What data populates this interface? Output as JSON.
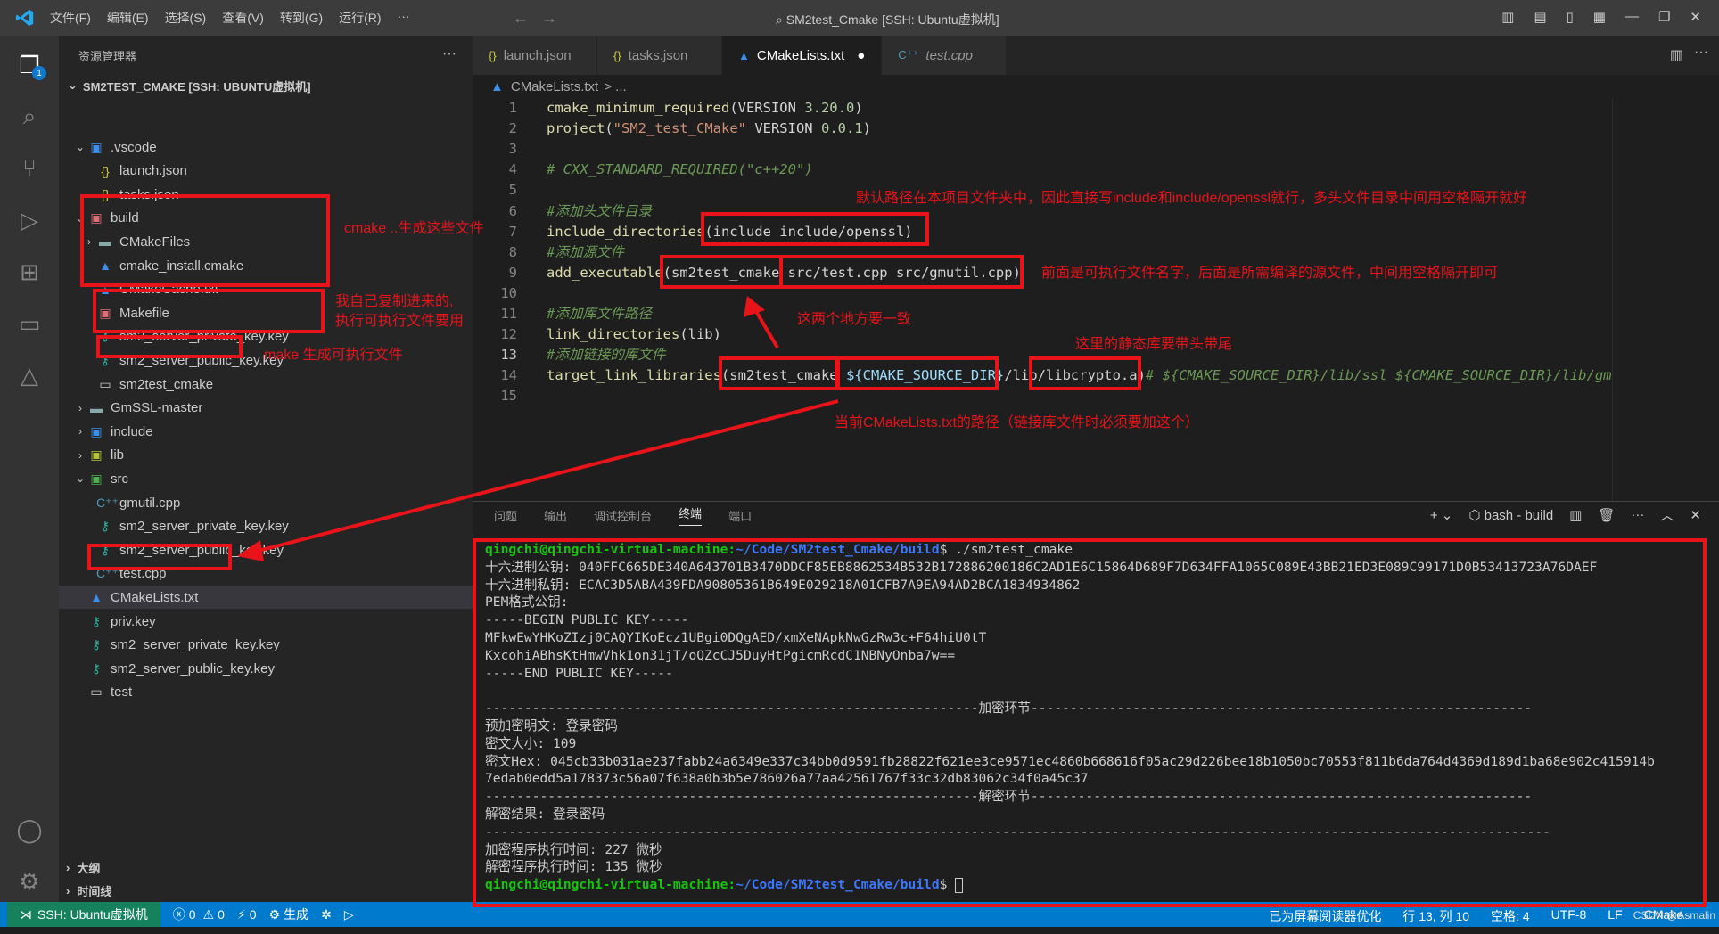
{
  "titlebar": {
    "menu": [
      "文件(F)",
      "编辑(E)",
      "选择(S)",
      "查看(V)",
      "转到(G)",
      "运行(R)",
      "···"
    ],
    "title": "SM2test_Cmake [SSH: Ubuntu虚拟机]"
  },
  "activity": {
    "badge": "1"
  },
  "sidebar": {
    "header": "资源管理器",
    "root": "SM2TEST_CMAKE [SSH: UBUNTU虚拟机]",
    "items": [
      {
        "label": ".vscode"
      },
      {
        "label": "launch.json"
      },
      {
        "label": "tasks.json"
      },
      {
        "label": "build"
      },
      {
        "label": "CMakeFiles"
      },
      {
        "label": "cmake_install.cmake"
      },
      {
        "label": "CMakeCache.txt"
      },
      {
        "label": "Makefile"
      },
      {
        "label": "sm2_server_private_key.key"
      },
      {
        "label": "sm2_server_public_key.key"
      },
      {
        "label": "sm2test_cmake"
      },
      {
        "label": "GmSSL-master"
      },
      {
        "label": "include"
      },
      {
        "label": "lib"
      },
      {
        "label": "src"
      },
      {
        "label": "gmutil.cpp"
      },
      {
        "label": "sm2_server_private_key.key"
      },
      {
        "label": "sm2_server_public_key.key"
      },
      {
        "label": "test.cpp"
      },
      {
        "label": "CMakeLists.txt"
      },
      {
        "label": "priv.key"
      },
      {
        "label": "sm2_server_private_key.key"
      },
      {
        "label": "sm2_server_public_key.key"
      },
      {
        "label": "test"
      }
    ],
    "outline": "大纲",
    "timeline": "时间线"
  },
  "tabs": [
    {
      "label": "launch.json"
    },
    {
      "label": "tasks.json"
    },
    {
      "label": "CMakeLists.txt"
    },
    {
      "label": "test.cpp"
    }
  ],
  "breadcrumb": {
    "file": "CMakeLists.txt",
    "rest": "> ..."
  },
  "editor": {
    "line_numbers": [
      "1",
      "2",
      "3",
      "4",
      "5",
      "6",
      "7",
      "8",
      "9",
      "10",
      "11",
      "12",
      "13",
      "14",
      "15"
    ],
    "current_line": 13,
    "lines": [
      [
        {
          "t": "fn",
          "v": "cmake_minimum_required"
        },
        {
          "t": "p",
          "v": "(VERSION "
        },
        {
          "t": "num",
          "v": "3.20.0"
        },
        {
          "t": "p",
          "v": ")"
        }
      ],
      [
        {
          "t": "fn",
          "v": "project"
        },
        {
          "t": "p",
          "v": "("
        },
        {
          "t": "str",
          "v": "\"SM2_test_CMake\""
        },
        {
          "t": "p",
          "v": " VERSION "
        },
        {
          "t": "num",
          "v": "0.0.1"
        },
        {
          "t": "p",
          "v": ")"
        }
      ],
      [],
      [
        {
          "t": "cmt",
          "v": "# CXX_STANDARD_REQUIRED(\"c++20\")"
        }
      ],
      [],
      [
        {
          "t": "cmt",
          "v": "#添加头文件目录"
        }
      ],
      [
        {
          "t": "fn",
          "v": "include_directories"
        },
        {
          "t": "p",
          "v": "(include include/openssl)"
        }
      ],
      [
        {
          "t": "cmt",
          "v": "#添加源文件"
        }
      ],
      [
        {
          "t": "fn",
          "v": "add_executable"
        },
        {
          "t": "p",
          "v": "(sm2test_cmake src/test.cpp src/gmutil.cpp)"
        }
      ],
      [],
      [
        {
          "t": "cmt",
          "v": "#添加库文件路径"
        }
      ],
      [
        {
          "t": "fn",
          "v": "link_directories"
        },
        {
          "t": "p",
          "v": "(lib)"
        }
      ],
      [
        {
          "t": "cmt",
          "v": "#添加链接的库文件"
        }
      ],
      [
        {
          "t": "fn",
          "v": "target_link_libraries"
        },
        {
          "t": "p",
          "v": "(sm2test_cmake "
        },
        {
          "t": "var",
          "v": "${CMAKE_SOURCE_DIR}"
        },
        {
          "t": "p",
          "v": "/lib/libcrypto.a)"
        },
        {
          "t": "cmt",
          "v": "# ${CMAKE_SOURCE_DIR}/lib/ssl ${CMAKE_SOURCE_DIR}/lib/gm"
        }
      ],
      []
    ]
  },
  "annotations": {
    "build_files": "cmake ..生成这些文件",
    "copied_keys_1": "我自己复制进来的,",
    "copied_keys_2": "执行可执行文件要用",
    "make_exec": "make 生成可执行文件",
    "include_note": "默认路径在本项目文件夹中，因此直接写include和include/openssl就行，多头文件目录中间用空格隔开就好",
    "exec_note": "前面是可执行文件名字，后面是所需编译的源文件，中间用空格隔开即可",
    "same_note": "这两个地方要一致",
    "static_lib_note": "这里的静态库要带头带尾",
    "cmake_path_note": "当前CMakeLists.txt的路径（链接库文件时必须要加这个）"
  },
  "panel": {
    "tabs": [
      "问题",
      "输出",
      "调试控制台",
      "终端",
      "端口"
    ],
    "active_tab": "终端",
    "shell": "bash - build"
  },
  "terminal": {
    "prompt_user": "qingchi@qingchi-virtual-machine",
    "prompt_path": "~/Code/SM2test_Cmake/build",
    "command": "$ ./sm2test_cmake",
    "final_prompt_suffix": "$ ",
    "output": [
      "十六进制公钥: 040FFC665DE340A643701B3470DDCF85EB8862534B532B172886200186C2AD1E6C15864D689F7D634FFA1065C089E43BB21ED3E089C99171D0B53413723A76DAEF",
      "十六进制私钥: ECAC3D5ABA439FDA90805361B649E029218A01CFB7A9EA94AD2BCA1834934862",
      "PEM格式公钥:",
      "-----BEGIN PUBLIC KEY-----",
      "MFkwEwYHKoZIzj0CAQYIKoEcz1UBgi0DQgAED/xmXeNApkNwGzRw3c+F64hiU0tT",
      "KxcohiABhsKtHmwVhk1on31jT/oQZcCJ5DuyHtPgicmRcdC1NBNyOnba7w==",
      "-----END PUBLIC KEY-----",
      "",
      "---------------------------------------------------------------加密环节----------------------------------------------------------------",
      "预加密明文: 登录密码",
      "密文大小: 109",
      "密文Hex: 045cb33b031ae237fabb24a6349e337c34bb0d9591fb28822f621ee3ce9571ec4860b668616f05ac29d226bee18b1050bc70553f811b6da764d4369d189d1ba68e902c415914b",
      "7edab0edd5a178373c56a07f638a0b3b5e786026a77aa42561767f33c32db83062c34f0a45c37",
      "---------------------------------------------------------------解密环节----------------------------------------------------------------",
      "解密结果: 登录密码",
      "----------------------------------------------------------------------------------------------------------------------------------------",
      "加密程序执行时间: 227 微秒",
      "解密程序执行时间: 135 微秒"
    ]
  },
  "statusbar": {
    "remote": "SSH: Ubuntu虚拟机",
    "errors": "0",
    "warnings": "0",
    "ports": "0",
    "build": "生成",
    "screen_reader": "已为屏幕阅读器优化",
    "position": "行 13, 列 10",
    "spaces": "空格: 4",
    "encoding": "UTF-8",
    "eol": "LF",
    "lang": "CMake",
    "watermark": "CSDN @Asmalin"
  },
  "colors": {
    "accent": "#007acc",
    "annotation": "#e8141a",
    "remote": "#16825d"
  }
}
